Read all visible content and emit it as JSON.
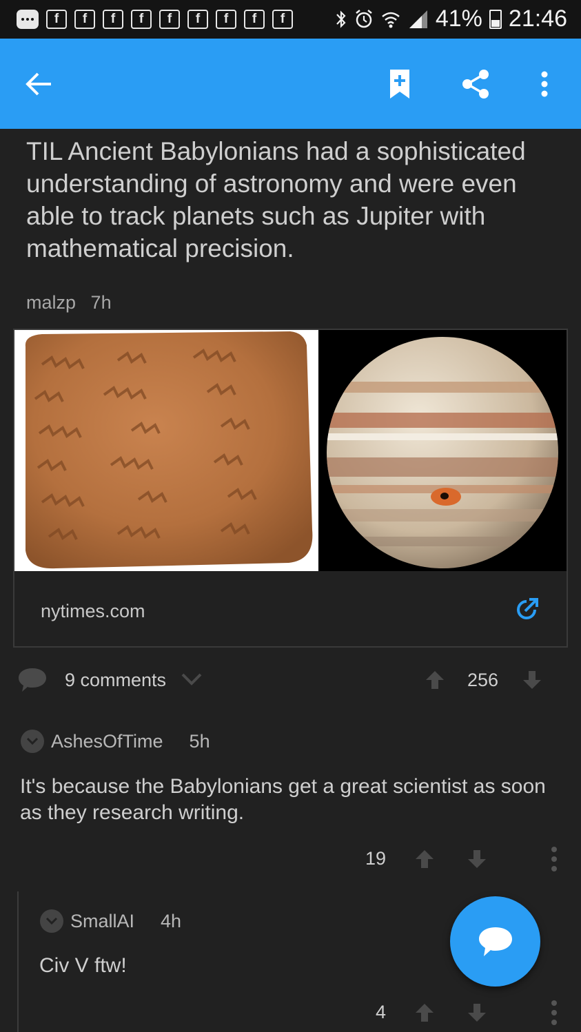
{
  "status_bar": {
    "battery": "41%",
    "time": "21:46",
    "notification_icons": [
      "more-notifications-icon",
      "flipboard-icon",
      "flipboard-icon",
      "flipboard-icon",
      "flipboard-icon",
      "flipboard-icon",
      "flipboard-icon",
      "flipboard-icon",
      "flipboard-icon",
      "flipboard-icon"
    ],
    "system_icons": [
      "bluetooth-icon",
      "alarm-icon",
      "wifi-icon",
      "signal-icon",
      "battery-icon"
    ]
  },
  "app_bar": {
    "color": "#2a9df4",
    "actions": [
      "back-arrow-icon",
      "save-bookmark-icon",
      "share-icon",
      "overflow-menu-icon"
    ]
  },
  "post": {
    "title": "TIL Ancient Babylonians had a sophisticated understanding of astronomy and were even able to track planets such as Jupiter with mathematical precision.",
    "author": "malzp",
    "age": "7h",
    "domain": "nytimes.com",
    "comments_label": "9 comments",
    "score": "256"
  },
  "comments": [
    {
      "author": "AshesOfTime",
      "age": "5h",
      "body": "It's because the Babylonians get a great scientist as soon as they research writing.",
      "score": "19"
    },
    {
      "author": "SmallAI",
      "age": "4h",
      "body": "Civ V ftw!",
      "score": "4"
    }
  ]
}
